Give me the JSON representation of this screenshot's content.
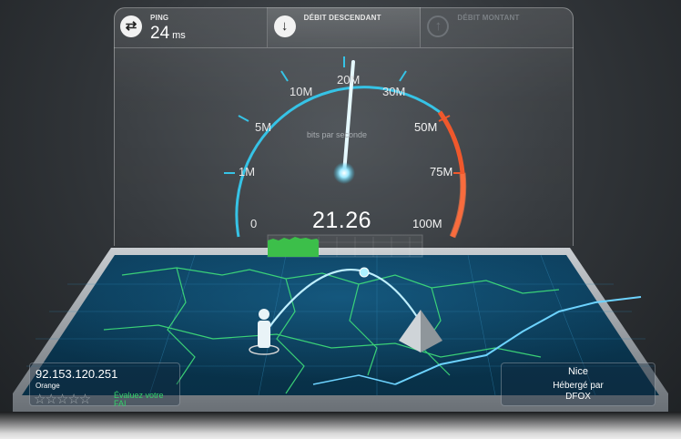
{
  "topbar": {
    "ping": {
      "label": "PING",
      "value": "24",
      "unit": "ms",
      "icon": "ping-icon"
    },
    "download": {
      "label": "DÉBIT DESCENDANT",
      "icon": "download-arrow-icon"
    },
    "upload": {
      "label": "DÉBIT MONTANT",
      "icon": "upload-arrow-icon"
    }
  },
  "gauge": {
    "labels": [
      "0",
      "1M",
      "5M",
      "10M",
      "20M",
      "30M",
      "50M",
      "75M",
      "100M"
    ],
    "unit_label": "bits par seconde",
    "result": "21.26",
    "needle_value": "20M",
    "colors": {
      "accent": "#36c3e6",
      "danger": "#f0582c",
      "bar": "#3cbf4a"
    }
  },
  "client": {
    "ip": "92.153.120.251",
    "isp": "Orange",
    "stars": "☆☆☆☆☆",
    "rate_label": "Évaluez votre FAI"
  },
  "server": {
    "city": "Nice",
    "hosted_by": "Hébergé par",
    "host": "DFOX"
  }
}
